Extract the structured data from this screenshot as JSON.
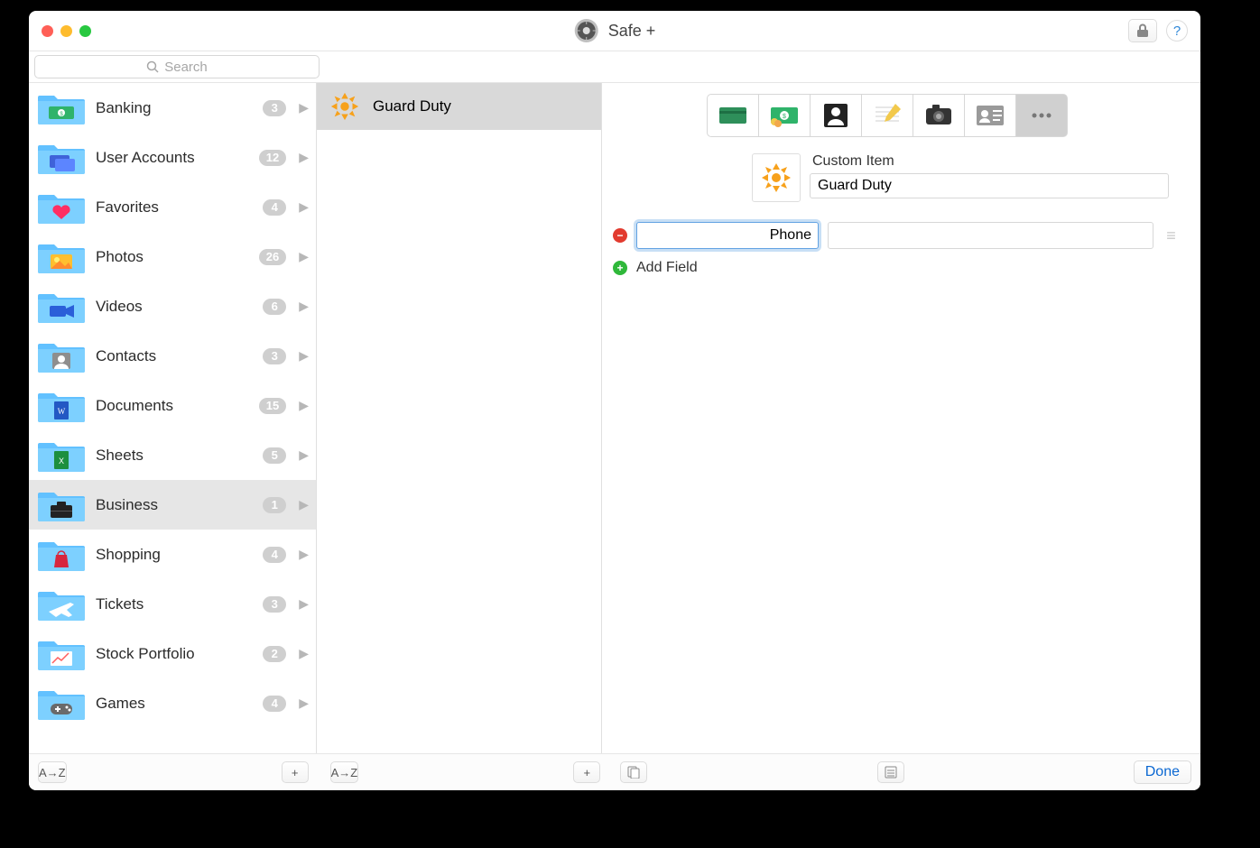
{
  "app": {
    "title": "Safe +"
  },
  "search": {
    "placeholder": "Search"
  },
  "categories": [
    {
      "id": "banking",
      "label": "Banking",
      "count": "3",
      "icon": "banknote"
    },
    {
      "id": "user-accounts",
      "label": "User Accounts",
      "count": "12",
      "icon": "accounts"
    },
    {
      "id": "favorites",
      "label": "Favorites",
      "count": "4",
      "icon": "heart"
    },
    {
      "id": "photos",
      "label": "Photos",
      "count": "26",
      "icon": "photos"
    },
    {
      "id": "videos",
      "label": "Videos",
      "count": "6",
      "icon": "video"
    },
    {
      "id": "contacts",
      "label": "Contacts",
      "count": "3",
      "icon": "contact"
    },
    {
      "id": "documents",
      "label": "Documents",
      "count": "15",
      "icon": "doc"
    },
    {
      "id": "sheets",
      "label": "Sheets",
      "count": "5",
      "icon": "sheet"
    },
    {
      "id": "business",
      "label": "Business",
      "count": "1",
      "icon": "briefcase",
      "selected": true
    },
    {
      "id": "shopping",
      "label": "Shopping",
      "count": "4",
      "icon": "bag"
    },
    {
      "id": "tickets",
      "label": "Tickets",
      "count": "3",
      "icon": "plane"
    },
    {
      "id": "stock-portfolio",
      "label": "Stock Portfolio",
      "count": "2",
      "icon": "chart"
    },
    {
      "id": "games",
      "label": "Games",
      "count": "4",
      "icon": "gamepad"
    }
  ],
  "items": [
    {
      "id": "guard-duty",
      "label": "Guard Duty",
      "selected": true
    }
  ],
  "detail": {
    "type_label": "Custom Item",
    "name": "Guard Duty",
    "fields": [
      {
        "label": "Phone",
        "value": ""
      }
    ],
    "add_field_label": "Add Field",
    "types": [
      {
        "id": "card",
        "icon": "card"
      },
      {
        "id": "bank",
        "icon": "banknote"
      },
      {
        "id": "account",
        "icon": "account"
      },
      {
        "id": "note",
        "icon": "note"
      },
      {
        "id": "photo",
        "icon": "camera"
      },
      {
        "id": "contact",
        "icon": "idcard"
      },
      {
        "id": "custom",
        "icon": "ellipsis",
        "selected": true
      }
    ]
  },
  "footer": {
    "sort_label": "A→Z",
    "done_label": "Done"
  }
}
